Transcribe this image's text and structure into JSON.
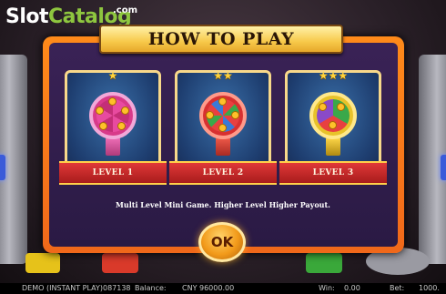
{
  "logo": {
    "part1": "Slot",
    "part2": "Catalog",
    "suffix": ".com"
  },
  "dialog": {
    "title": "HOW TO PLAY",
    "description": "Multi Level Mini Game. Higher Level Higher Payout.",
    "ok_label": "OK"
  },
  "levels": [
    {
      "label": "LEVEL 1",
      "stars": "★",
      "star_count": 1
    },
    {
      "label": "LEVEL 2",
      "stars": "★★",
      "star_count": 2
    },
    {
      "label": "LEVEL 3",
      "stars": "★★★",
      "star_count": 3
    }
  ],
  "status_bar": {
    "mode": "DEMO (INSTANT PLAY)087138",
    "balance_label": "Balance:",
    "balance_value": "CNY 96000.00",
    "win_label": "Win:",
    "win_value": "0.00",
    "bet_label": "Bet:",
    "bet_value": "1000."
  },
  "colors": {
    "panel_orange": "#f0681a",
    "panel_inner": "#2a1a44",
    "title_gold": "#f7c94a",
    "ribbon_red": "#c02626",
    "star_gold": "#ffd23a",
    "logo_green": "#8ec63f"
  }
}
